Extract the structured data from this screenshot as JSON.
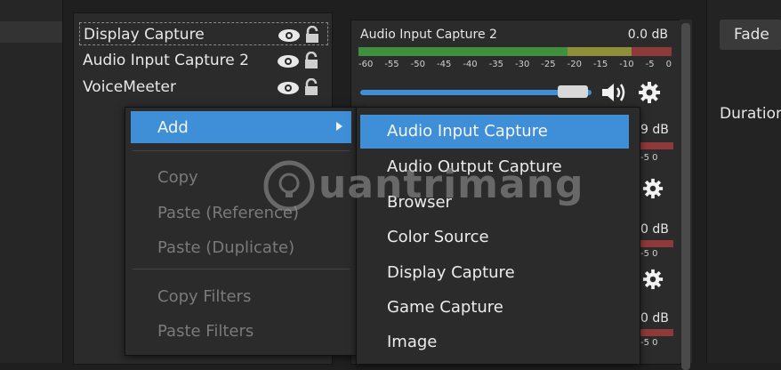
{
  "sources": {
    "items": [
      {
        "label": "Display Capture",
        "selected": true
      },
      {
        "label": "Audio Input Capture 2",
        "selected": false
      },
      {
        "label": "VoiceMeeter",
        "selected": false
      }
    ],
    "icons": [
      "eye-icon",
      "lock-icon"
    ]
  },
  "mixer": {
    "channel_name": "Audio Input Capture 2",
    "db": "0.0 dB",
    "ticks": [
      "-60",
      "-55",
      "-50",
      "-45",
      "-40",
      "-35",
      "-30",
      "-25",
      "-20",
      "-15",
      "-10",
      "-5",
      "0"
    ],
    "volume_level": 0.95,
    "partial_rows": [
      {
        "db": "9 dB",
        "ticks": "-5   0"
      },
      {
        "db": "0 dB",
        "ticks": "-5   0"
      },
      {
        "db": "0 dB",
        "ticks": "-5   0"
      }
    ]
  },
  "transition": {
    "fade_label": "Fade",
    "duration_label": "Duration"
  },
  "context_menu": {
    "add_label": "Add",
    "copy_label": "Copy",
    "paste_reference_label": "Paste (Reference)",
    "paste_duplicate_label": "Paste (Duplicate)",
    "copy_filters_label": "Copy Filters",
    "paste_filters_label": "Paste Filters"
  },
  "submenu": {
    "items": [
      "Audio Input Capture",
      "Audio Output Capture",
      "Browser",
      "Color Source",
      "Display Capture",
      "Game Capture",
      "Image"
    ]
  },
  "watermark": {
    "text": "uantrimang"
  },
  "colors": {
    "accent": "#3f8fd8",
    "background": "#1f1f1f",
    "panel": "#2b2b2b",
    "meter_green": "#3e8f3e",
    "meter_yellow": "#8f8f3a",
    "meter_red": "#8f3a3a"
  }
}
